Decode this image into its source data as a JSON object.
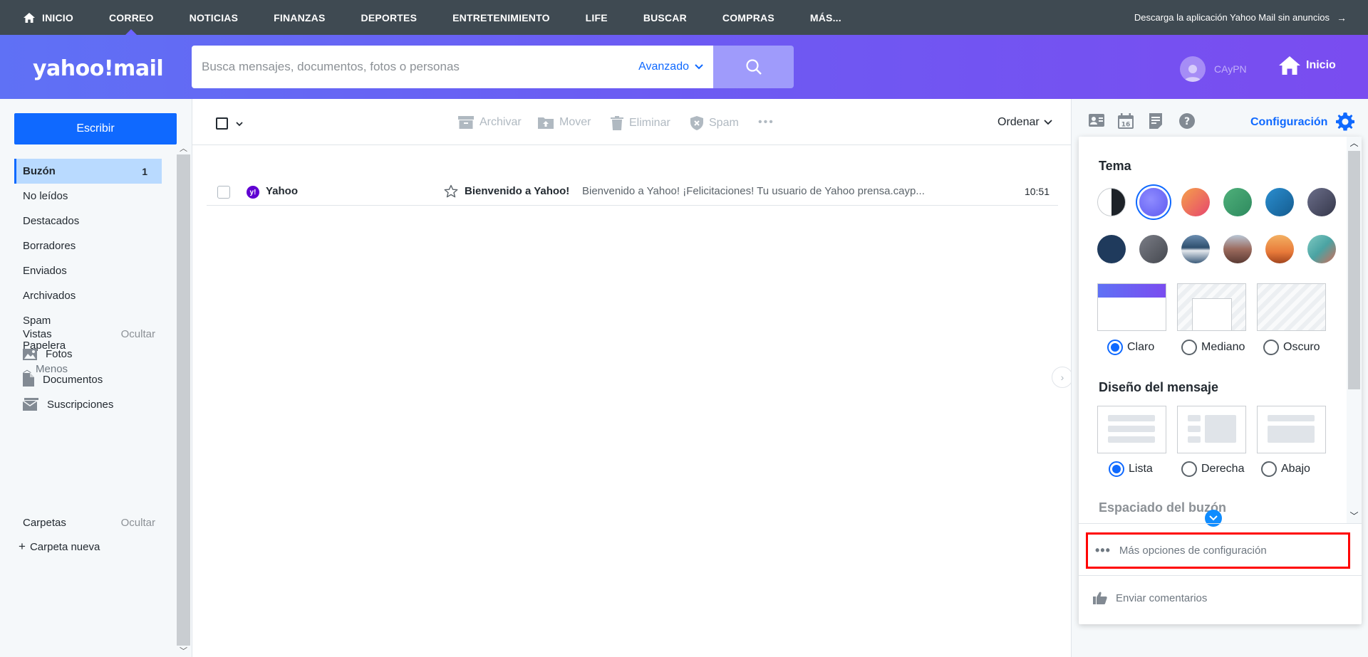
{
  "topnav": {
    "items": [
      {
        "label": "INICIO"
      },
      {
        "label": "CORREO"
      },
      {
        "label": "NOTICIAS"
      },
      {
        "label": "FINANZAS"
      },
      {
        "label": "DEPORTES"
      },
      {
        "label": "ENTRETENIMIENTO"
      },
      {
        "label": "LIFE"
      },
      {
        "label": "BUSCAR"
      },
      {
        "label": "COMPRAS"
      },
      {
        "label": "MÁS..."
      }
    ],
    "active_index": 1,
    "promo": "Descarga la aplicación Yahoo Mail sin anuncios",
    "promo_arrow": "→"
  },
  "header": {
    "logo": "yahoo!mail",
    "search_placeholder": "Busca mensajes, documentos, fotos o personas",
    "advanced_label": "Avanzado",
    "user_name": "CAyPN",
    "home_label": "Inicio"
  },
  "sidebar": {
    "compose_label": "Escribir",
    "folders": [
      {
        "label": "Buzón",
        "count": "1"
      },
      {
        "label": "No leídos"
      },
      {
        "label": "Destacados"
      },
      {
        "label": "Borradores"
      },
      {
        "label": "Enviados"
      },
      {
        "label": "Archivados"
      },
      {
        "label": "Spam"
      },
      {
        "label": "Papelera"
      }
    ],
    "less_label": "Menos",
    "views_label": "Vistas",
    "views_hide": "Ocultar",
    "views": [
      {
        "label": "Fotos"
      },
      {
        "label": "Documentos"
      },
      {
        "label": "Suscripciones"
      }
    ],
    "folders_label": "Carpetas",
    "folders_hide": "Ocultar",
    "new_folder": "Carpeta nueva"
  },
  "toolbar": {
    "archive": "Archivar",
    "move": "Mover",
    "delete": "Eliminar",
    "spam": "Spam",
    "more": "•••",
    "sort": "Ordenar"
  },
  "messages": [
    {
      "from": "Yahoo",
      "subject": "Bienvenido a Yahoo!",
      "snippet": "Bienvenido a Yahoo! ¡Felicitaciones! Tu usuario de Yahoo prensa.cayp...",
      "time": "10:51"
    }
  ],
  "rightrail": {
    "config_label": "Configuración"
  },
  "settings": {
    "theme_title": "Tema",
    "swatches_row1": [
      "#1d2228",
      "#6f6cff",
      "#f26b5b",
      "#3f9a6c",
      "#1e6fa8",
      "#4b4e68"
    ],
    "swatches_row2": [
      "#1f3a5c",
      "#5a5d66",
      "#2e4f6e",
      "#9c6b5e",
      "#e87a3a",
      "#4aa3a3"
    ],
    "accent_color": "#0f69ff",
    "brand_color": "#6b5cf3",
    "mode_options": [
      {
        "label": "Claro"
      },
      {
        "label": "Mediano"
      },
      {
        "label": "Oscuro"
      }
    ],
    "mode_selected": 0,
    "layout_title": "Diseño del mensaje",
    "layout_options": [
      {
        "label": "Lista"
      },
      {
        "label": "Derecha"
      },
      {
        "label": "Abajo"
      }
    ],
    "layout_selected": 0,
    "spacing_title": "Espaciado del buzón",
    "more_options": "Más opciones de configuración",
    "feedback": "Enviar comentarios"
  }
}
